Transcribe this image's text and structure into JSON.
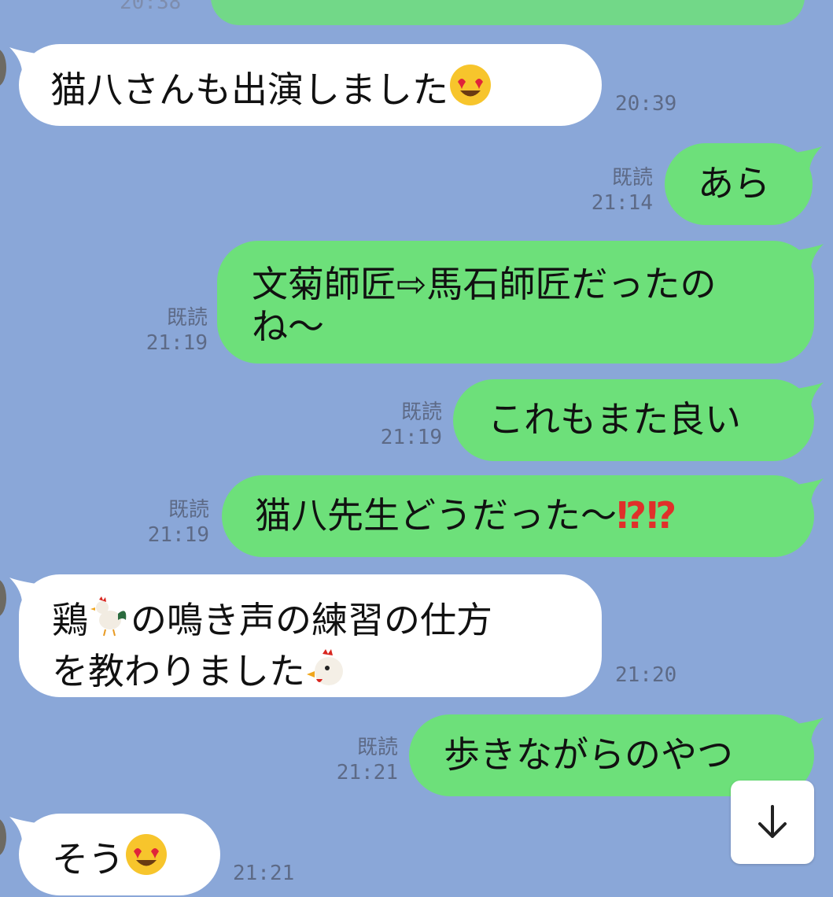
{
  "top_partial": {
    "time": "20:38"
  },
  "messages": [
    {
      "side": "in",
      "lines": [
        "猫八さんも出演しました"
      ],
      "emoji": "smiling-face-with-heart-eyes",
      "time": "20:39"
    },
    {
      "side": "out",
      "lines": [
        "あら"
      ],
      "read": "既読",
      "time": "21:14"
    },
    {
      "side": "out",
      "lines": [
        "文菊師匠⇨馬石師匠だったの",
        "ね〜"
      ],
      "read": "既読",
      "time": "21:19"
    },
    {
      "side": "out",
      "lines": [
        "これもまた良い"
      ],
      "read": "既読",
      "time": "21:19"
    },
    {
      "side": "out",
      "lines": [
        "猫八先生どうだった〜"
      ],
      "suffix": "⁉⁉",
      "read": "既読",
      "time": "21:19"
    },
    {
      "side": "in",
      "lines": [
        "鶏",
        "の鳴き声の練習の仕方",
        "を教わりました"
      ],
      "emoji": "rooster-and-chicken",
      "time": "21:20"
    },
    {
      "side": "out",
      "lines": [
        "歩きながらのやつ"
      ],
      "read": "既読",
      "time": "21:21"
    },
    {
      "side": "in",
      "lines": [
        "そう"
      ],
      "emoji": "smiling-face-with-heart-eyes",
      "time": "21:21"
    }
  ],
  "colors": {
    "background": "#8aa7d8",
    "outgoing_bubble": "#6de07a",
    "incoming_bubble": "#ffffff",
    "meta_text": "#5d6a86"
  },
  "controls": {
    "scroll_down_icon": "arrow-down-icon"
  }
}
